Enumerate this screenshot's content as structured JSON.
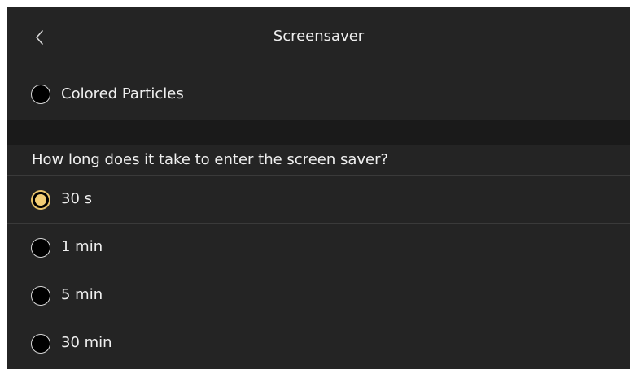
{
  "header": {
    "back_icon": "chevron-left-icon",
    "title": "Screensaver"
  },
  "screensaver_option": {
    "label": "Colored Particles",
    "selected": false
  },
  "timeout": {
    "question": "How long does it take to enter the screen saver?",
    "options": [
      {
        "label": "30 s",
        "selected": true
      },
      {
        "label": "1 min",
        "selected": false
      },
      {
        "label": "5 min",
        "selected": false
      },
      {
        "label": "30 min",
        "selected": false
      }
    ]
  },
  "colors": {
    "background": "#242424",
    "band": "#1a1a1a",
    "accent": "#f2cd74",
    "text": "#f0f0f0"
  }
}
